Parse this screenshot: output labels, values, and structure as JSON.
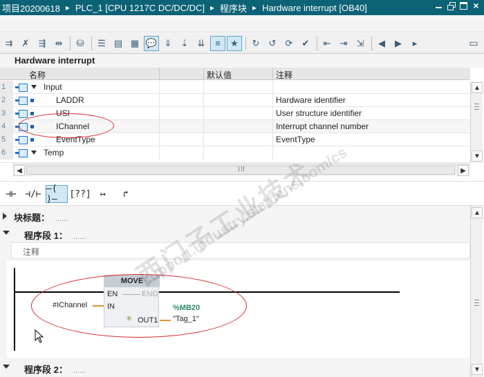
{
  "titlebar": {
    "project": "项目20200618",
    "plc": "PLC_1 [CPU 1217C DC/DC/DC]",
    "folder": "程序块",
    "block": "Hardware interrupt [OB40]",
    "separator": "▸"
  },
  "block_title": "Hardware interrupt",
  "interface": {
    "headers": {
      "name": "名称",
      "default": "默认值",
      "comment": "注释"
    },
    "rows": [
      {
        "num": "1",
        "name": "Input",
        "comment": "",
        "kind": "section"
      },
      {
        "num": "2",
        "name": "LADDR",
        "comment": "Hardware identifier",
        "kind": "var"
      },
      {
        "num": "3",
        "name": "USI",
        "comment": "User structure identifier",
        "kind": "var"
      },
      {
        "num": "4",
        "name": "IChannel",
        "comment": "Interrupt channel number",
        "kind": "var"
      },
      {
        "num": "5",
        "name": "EventType",
        "comment": "EventType",
        "kind": "var"
      },
      {
        "num": "6",
        "name": "Temp",
        "comment": "",
        "kind": "section"
      }
    ]
  },
  "instruction_bar": [
    {
      "label": "⊣⊢",
      "name": "no-contact-button"
    },
    {
      "label": "⊣/⊢",
      "name": "nc-contact-button"
    },
    {
      "label": "–( )–",
      "name": "coil-button"
    },
    {
      "label": "[??]",
      "name": "empty-box-button"
    },
    {
      "label": "↦",
      "name": "open-branch-button"
    },
    {
      "label": "↱",
      "name": "close-branch-button"
    }
  ],
  "network_area": {
    "block_title_label": "块标题：",
    "block_title_dots": "......",
    "network1_label": "程序段 1：",
    "network1_dots": "......",
    "comment_placeholder": "注释",
    "network2_label": "程序段 2：",
    "network2_dots": "......"
  },
  "move_box": {
    "title": "MOVE",
    "en": "EN",
    "eno": "ENO",
    "in": "IN",
    "out": "OUT1",
    "in_operand": "#IChannel",
    "out_address": "%MB20",
    "out_tag": "\"Tag_1\""
  },
  "watermark": {
    "cn": "西门子工业技术",
    "en": "support.industry.siemens.com/cs"
  },
  "colors": {
    "titlebar_bg": "#0c6276",
    "annotation": "#d9252a",
    "wire": "#e88f2d",
    "address": "#2b8a6a"
  }
}
